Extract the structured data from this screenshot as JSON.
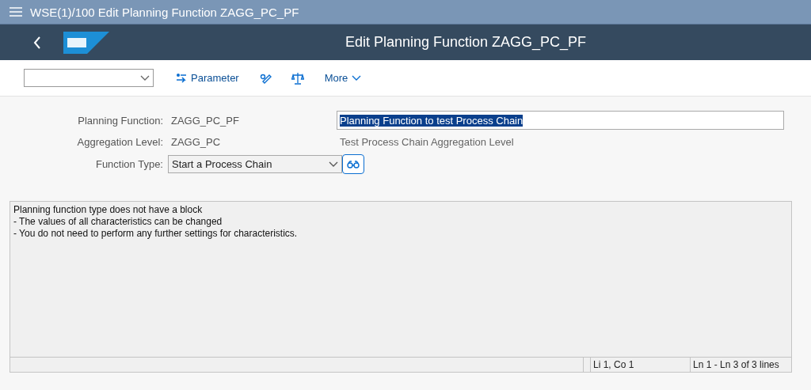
{
  "window": {
    "title": "WSE(1)/100 Edit Planning Function ZAGG_PC_PF"
  },
  "header": {
    "title": "Edit Planning Function ZAGG_PC_PF"
  },
  "toolbar": {
    "buttons": [
      {
        "kind": "parameter",
        "label": "Parameter"
      },
      {
        "kind": "edit"
      },
      {
        "kind": "balance"
      },
      {
        "kind": "more",
        "label": "More"
      }
    ]
  },
  "form": {
    "planning_function": {
      "label": "Planning Function:",
      "value": "ZAGG_PC_PF",
      "description": "Planning Function to test Process Chain",
      "description_selected": true
    },
    "aggregation_level": {
      "label": "Aggregation Level:",
      "value": "ZAGG_PC",
      "description": "Test Process Chain Aggregation Level"
    },
    "function_type": {
      "label": "Function Type:",
      "value": "Start a Process Chain"
    }
  },
  "text_editor": {
    "lines": [
      "Planning function type does not have a block",
      "- The values of all characteristics can be changed",
      "- You do not need to perform any further settings for characteristics."
    ],
    "status": [
      "Li 1, Co 1",
      "Ln 1 - Ln 3 of 3 lines"
    ]
  }
}
